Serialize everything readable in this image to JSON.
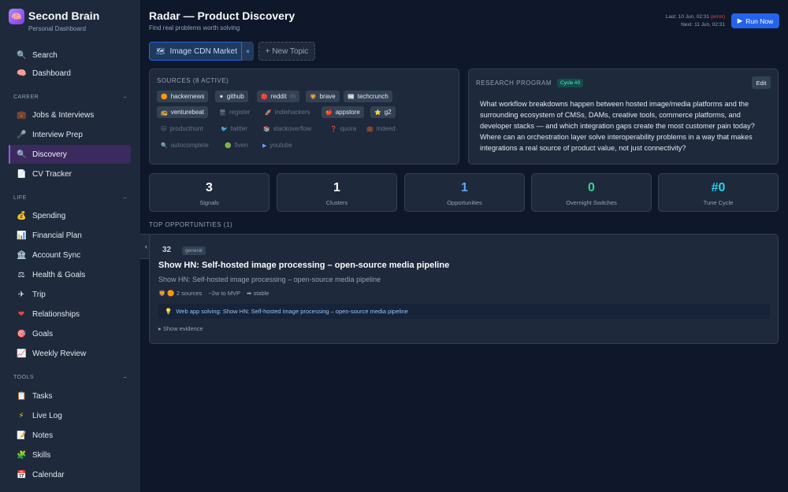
{
  "brand": {
    "title": "Second Brain",
    "subtitle": "Personal Dashboard",
    "icon": "brain-icon"
  },
  "nav": {
    "search": {
      "label": "Search",
      "icon": "🔍"
    },
    "dashboard": {
      "label": "Dashboard",
      "icon": "🧠"
    },
    "career_label": "CAREER",
    "career": [
      {
        "label": "Jobs & Interviews",
        "icon": "💼"
      },
      {
        "label": "Interview Prep",
        "icon": "🎤"
      },
      {
        "label": "Discovery",
        "icon": "🔍",
        "active": true
      },
      {
        "label": "CV Tracker",
        "icon": "📄"
      }
    ],
    "life_label": "LIFE",
    "life": [
      {
        "label": "Spending",
        "icon": "💰"
      },
      {
        "label": "Financial Plan",
        "icon": "📊"
      },
      {
        "label": "Account Sync",
        "icon": "🏦"
      },
      {
        "label": "Health & Goals",
        "icon": "⚖"
      },
      {
        "label": "Trip",
        "icon": "✈"
      },
      {
        "label": "Relationships",
        "icon": "❤"
      },
      {
        "label": "Goals",
        "icon": "🎯"
      },
      {
        "label": "Weekly Review",
        "icon": "📈"
      }
    ],
    "tools_label": "TOOLS",
    "tools": [
      {
        "label": "Tasks",
        "icon": "📋"
      },
      {
        "label": "Live Log",
        "icon": "⚡"
      },
      {
        "label": "Notes",
        "icon": "📝"
      },
      {
        "label": "Skills",
        "icon": "🧩"
      },
      {
        "label": "Calendar",
        "icon": "📅"
      }
    ],
    "collapse_chevron": "–"
  },
  "header": {
    "title": "Radar — Product Discovery",
    "subtitle": "Find real problems worth solving",
    "last_run_prefix": "Last: 10 Jun, 02:31",
    "last_run_status": "(error)",
    "next_run": "Next: 11 Jun, 02:31",
    "run_button": "Run Now"
  },
  "topics": {
    "active": "Image CDN Market",
    "close": "×",
    "new_topic": "+ New Topic"
  },
  "sources": {
    "title": "SOURCES (8 ACTIVE)",
    "chips": [
      {
        "label": "hackernews",
        "icon": "🟠",
        "active": true
      },
      {
        "label": "github",
        "icon": "⚫",
        "active": true
      },
      {
        "label": "reddit",
        "icon": "🔴",
        "active": true,
        "tag": "(8)"
      },
      {
        "label": "brave",
        "icon": "🦁",
        "active": true
      },
      {
        "label": "techcrunch",
        "icon": "📰",
        "active": true
      },
      {
        "label": "venturebeat",
        "icon": "📻",
        "active": true
      },
      {
        "label": "register",
        "icon": "🖥",
        "active": false
      },
      {
        "label": "indiehackers",
        "icon": "🚀",
        "active": false
      },
      {
        "label": "appstore",
        "icon": "🍎",
        "active": true
      },
      {
        "label": "g2",
        "icon": "⭐",
        "active": true
      },
      {
        "label": "producthunt",
        "icon": "🐱",
        "active": false
      },
      {
        "label": "twitter",
        "icon": "🐦",
        "active": false
      },
      {
        "label": "stackoverflow",
        "icon": "📚",
        "active": false
      },
      {
        "label": "quora",
        "icon": "❓",
        "active": false
      },
      {
        "label": "indeed",
        "icon": "💼",
        "active": false
      },
      {
        "label": "autocomplete",
        "icon": "🔍",
        "active": false
      },
      {
        "label": "fiverr",
        "icon": "🟢",
        "active": false
      },
      {
        "label": "youtube",
        "icon": "▶",
        "active": false
      }
    ]
  },
  "research": {
    "title": "RESEARCH PROGRAM",
    "cycle": "Cycle #0",
    "edit": "Edit",
    "text": "What workflow breakdowns happen between hosted image/media platforms and the surrounding ecosystem of CMSs, DAMs, creative tools, commerce platforms, and developer stacks — and which integration gaps create the most customer pain today? Where can an orchestration layer solve interoperability problems in a way that makes integrations a real source of product value, not just connectivity?"
  },
  "stats": [
    {
      "value": "3",
      "label": "Signals",
      "color": "#f8fafc"
    },
    {
      "value": "1",
      "label": "Clusters",
      "color": "#f8fafc"
    },
    {
      "value": "1",
      "label": "Opportunities",
      "color": "#60a5fa"
    },
    {
      "value": "0",
      "label": "Overnight Switches",
      "color": "#34d399"
    },
    {
      "value": "#0",
      "label": "Tune Cycle",
      "color": "#22d3ee"
    }
  ],
  "opportunities": {
    "title": "TOP OPPORTUNITIES (1)",
    "items": [
      {
        "score": "32",
        "category": "general",
        "title": "Show HN: Self-hosted image processing – open-source media pipeline",
        "description": "Show HN: Self-hosted image processing – open-source media pipeline",
        "sources": "2 sources",
        "mvp": "~2w to MVP",
        "trend": "stable",
        "solving": "Web app solving: Show HN: Self-hosted image processing – open-source media pipeline",
        "show_evidence": "Show evidence"
      }
    ]
  },
  "colors": {
    "accent": "#2563eb",
    "active_nav": "#3b2a5e",
    "bg": "#0f172a",
    "panel": "#1e293b"
  }
}
